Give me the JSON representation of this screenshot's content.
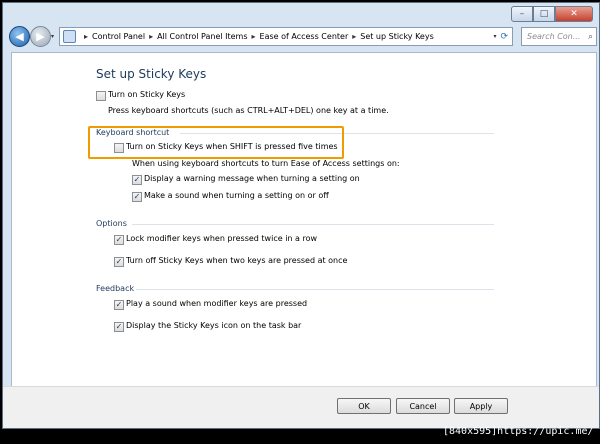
{
  "window": {
    "minimize": "–",
    "maximize": "□",
    "close": "✕"
  },
  "nav": {
    "back_glyph": "◀",
    "forward_glyph": "▶",
    "history_glyph": "▾",
    "address_dropdown_glyph": "▾",
    "refresh_glyph": "⟳",
    "separator": "▸",
    "breadcrumbs": [
      "Control Panel",
      "All Control Panel Items",
      "Ease of Access Center",
      "Set up Sticky Keys"
    ],
    "search_placeholder": "Search Con...",
    "search_glyph": "⌕"
  },
  "page": {
    "title": "Set up Sticky Keys",
    "turn_on": {
      "label": "Turn on Sticky Keys",
      "checked": false
    },
    "turn_on_desc": "Press keyboard shortcuts (such as CTRL+ALT+DEL) one key at a time.",
    "keyboard_shortcut": {
      "heading": "Keyboard shortcut",
      "shift_five": {
        "label": "Turn on Sticky Keys when SHIFT is pressed five times",
        "checked": false
      },
      "note": "When using keyboard shortcuts to turn Ease of Access settings on:",
      "warning": {
        "label": "Display a warning message when turning a setting on",
        "checked": true
      },
      "sound": {
        "label": "Make a sound when turning a setting on or off",
        "checked": true
      }
    },
    "options": {
      "heading": "Options",
      "lock": {
        "label": "Lock modifier keys when pressed twice in a row",
        "checked": true
      },
      "turn_off": {
        "label": "Turn off Sticky Keys when two keys are pressed at once",
        "checked": true
      }
    },
    "feedback": {
      "heading": "Feedback",
      "play_sound": {
        "label": "Play a sound when modifier keys are pressed",
        "checked": true
      },
      "display_icon": {
        "label": "Display the Sticky Keys icon on the task bar",
        "checked": true
      }
    }
  },
  "buttons": {
    "ok": "OK",
    "cancel": "Cancel",
    "apply": "Apply"
  },
  "caption": "[840x595]https://upic.me/",
  "colors": {
    "highlight": "#f29b00",
    "heading": "#1e395b"
  }
}
